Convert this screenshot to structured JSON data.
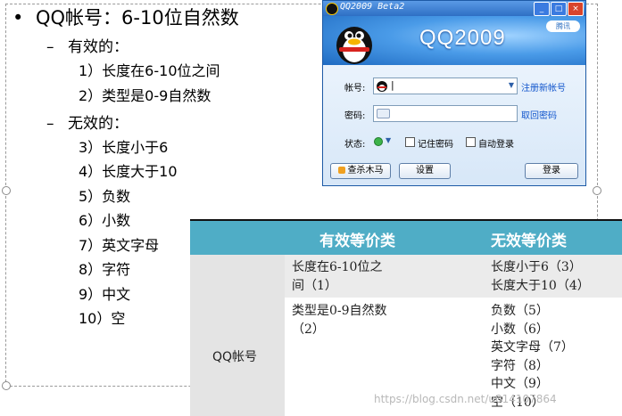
{
  "slide": {
    "title": "QQ帐号：6-10位自然数",
    "valid_heading": "有效的：",
    "valid_items": [
      "1）长度在6-10位之间",
      "2）类型是0-9自然数"
    ],
    "invalid_heading": "无效的：",
    "invalid_items": [
      "3）长度小于6",
      "4）长度大于10",
      "5）负数",
      "6）小数",
      "7）英文字母",
      "8）字符",
      "9）中文",
      "10）空"
    ]
  },
  "qq_window": {
    "title": "QQ2009 Beta2",
    "brand": "QQ2009",
    "badge": "腾讯",
    "account_label": "帐号:",
    "account_value": "|",
    "register_link": "注册新帐号",
    "password_label": "密码:",
    "recover_link": "取回密码",
    "status_label": "状态:",
    "remember_label": "记住密码",
    "autologin_label": "自动登录",
    "antivirus_button": "查杀木马",
    "settings_button": "设置",
    "login_button": "登录",
    "minimize": "_",
    "maximize": "□",
    "close": "×"
  },
  "table": {
    "col_valid": "有效等价类",
    "col_invalid": "无效等价类",
    "row_label": "QQ帐号",
    "r1_valid": [
      "长度在6-10位之",
      "间（1）"
    ],
    "r1_invalid": [
      "长度小于6（3）",
      "长度大于10（4）"
    ],
    "r2_valid": [
      "类型是0-9自然数",
      "（2）"
    ],
    "r2_invalid": [
      "负数（5）",
      "小数（6）",
      "英文字母（7）",
      "字符（8）",
      "中文（9）",
      "空（10）"
    ]
  },
  "watermark": "https://blog.csdn.net/u014107864",
  "colors": {
    "table_header": "#4fadc6",
    "qq_blue": "#2f7fd4",
    "link": "#1155cc"
  }
}
